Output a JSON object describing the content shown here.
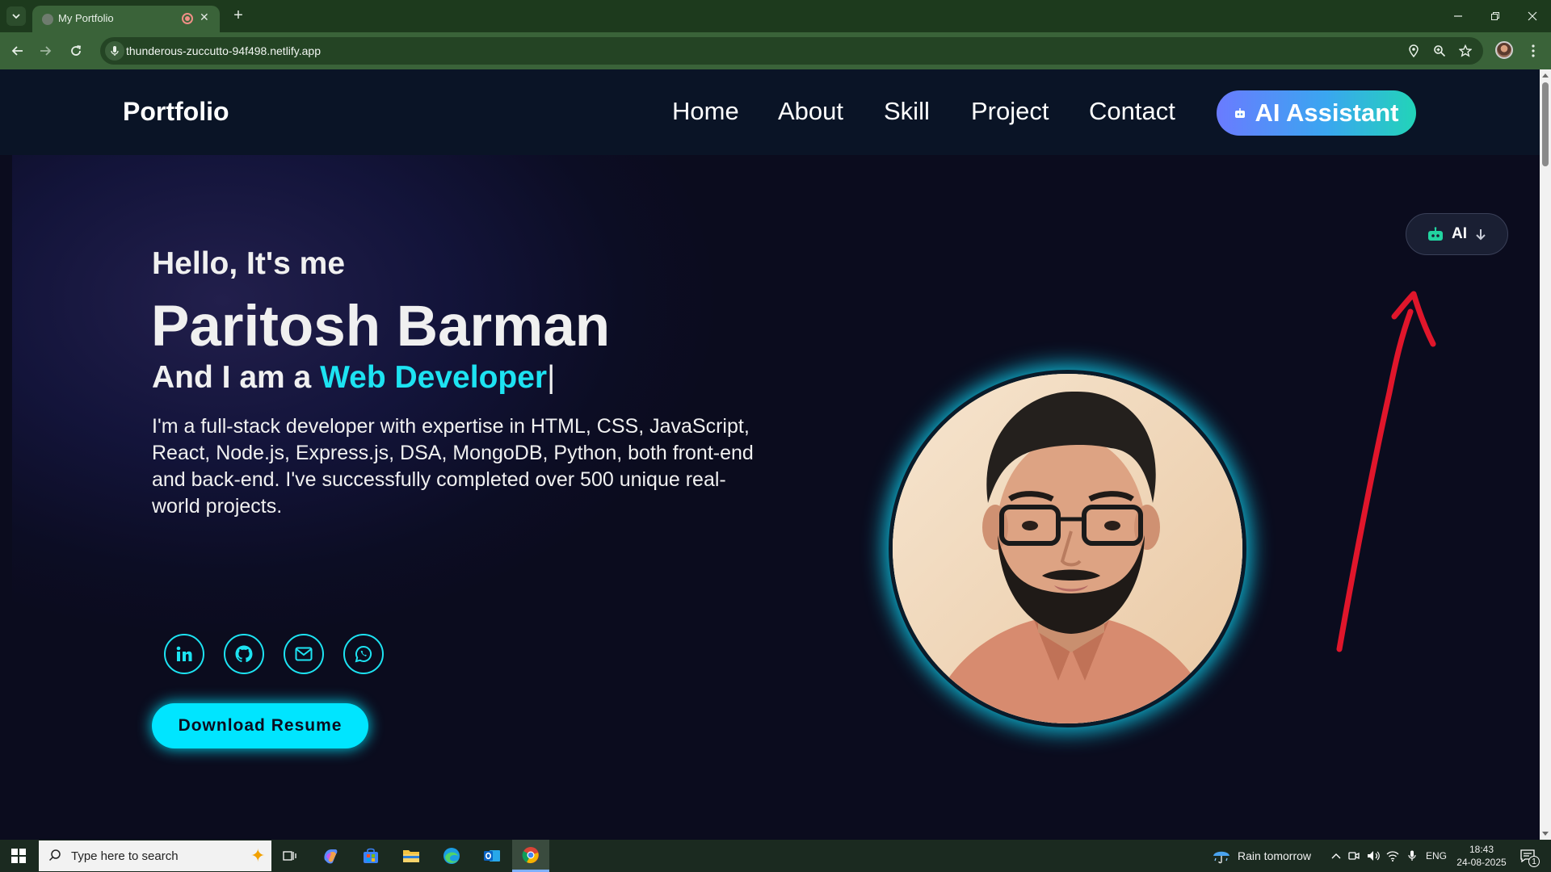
{
  "browser": {
    "tab": {
      "title": "My Portfolio"
    },
    "url": "thunderous-zuccutto-94f498.netlify.app"
  },
  "site": {
    "logo": "Portfolio",
    "nav": [
      {
        "label": "Home"
      },
      {
        "label": "About"
      },
      {
        "label": "Skill"
      },
      {
        "label": "Project"
      },
      {
        "label": "Contact"
      }
    ],
    "ai_button_label": "AI Assistant",
    "ai_toggle_label": "AI"
  },
  "hero": {
    "greeting": "Hello, It's me",
    "name": "Paritosh Barman",
    "role_prefix": "And I am a",
    "role": "Web Developer",
    "caret": "|",
    "bio": "I'm a full-stack developer with expertise in HTML, CSS, JavaScript, React, Node.js, Express.js, DSA, MongoDB, Python, both front-end and back-end. I've successfully completed over 500 unique real-world projects.",
    "socials": [
      "linkedin-icon",
      "github-icon",
      "mail-icon",
      "whatsapp-icon"
    ],
    "download_label": "Download Resume"
  },
  "annotation": {
    "color": "#e0162b"
  },
  "taskbar": {
    "search_placeholder": "Type here to search",
    "weather": "Rain tomorrow",
    "language": "ENG",
    "time": "18:43",
    "date": "24-08-2025",
    "notification_count": "1"
  },
  "colors": {
    "accent": "#1de3f2",
    "page_bg": "#0b0c1e",
    "browser_frame": "#3a6339"
  }
}
